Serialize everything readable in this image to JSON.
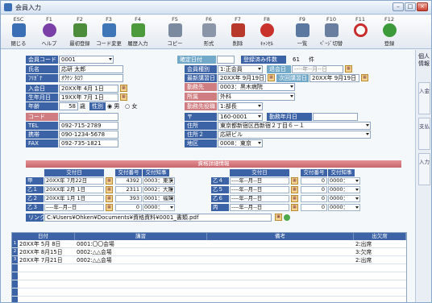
{
  "window": {
    "title": "会員入力",
    "min": "–",
    "max": "□",
    "close": "×"
  },
  "toolbar": [
    {
      "key": "ESC",
      "label": "閉じる",
      "icon": "monitor-icon",
      "color": "#3a6fb5"
    },
    {
      "key": "F1",
      "label": "ヘルプ",
      "icon": "help-icon",
      "color": "#7b3fa8"
    },
    {
      "key": "F2",
      "label": "最初登録",
      "icon": "register-icon",
      "color": "#4c8c3a"
    },
    {
      "key": "F3",
      "label": "コード変更",
      "icon": "code-change-icon",
      "color": "#3e76b8"
    },
    {
      "key": "F4",
      "label": "履歴入力",
      "icon": "history-icon",
      "color": "#4c9a3c"
    },
    {
      "key": "F5",
      "label": "コピー",
      "icon": "copy-icon",
      "color": "#7c8aa0"
    },
    {
      "key": "F6",
      "label": "形式",
      "icon": "format-icon",
      "color": "#8a95a8"
    },
    {
      "key": "F7",
      "label": "削除",
      "icon": "delete-icon",
      "color": "#b8392c"
    },
    {
      "key": "F8",
      "label": "ｷｬﾝｾﾙ",
      "icon": "cancel-icon",
      "color": "#c9322b"
    },
    {
      "key": "F9",
      "label": "一覧",
      "icon": "list-icon",
      "color": "#5a78a0"
    },
    {
      "key": "F10",
      "label": "ﾍﾟｰｼﾞ切替",
      "icon": "page-switch-icon",
      "color": "#6a7ea0"
    },
    {
      "key": "F11",
      "label": "",
      "icon": "prohibit-icon",
      "color": "#c82c2c"
    },
    {
      "key": "F12",
      "label": "登録",
      "icon": "save-check-icon",
      "color": "#3d9a3a"
    }
  ],
  "sidebar": {
    "title": "個人情報",
    "tabs": [
      "入金",
      "支払",
      "入力"
    ]
  },
  "form": {
    "member_code_label": "会員コード",
    "member_code": "0001",
    "name_label": "氏名",
    "name": "応研 太郎",
    "kana_label": "ﾌﾘｶﾞﾅ",
    "kana": "ｵｳｹﾝ ﾀﾛｳ",
    "join_label": "入会日",
    "join_date": "20XX年 4月 1日",
    "birth_label": "生年月日",
    "birth_date": "19XX年 7月 1日",
    "age_label": "年齢",
    "age": "58",
    "age_unit": "歳",
    "gender_label": "性別",
    "gender_male": "男",
    "gender_female": "女",
    "code_label": "コード",
    "code": "",
    "tel_label": "TEL",
    "tel": "092-715-2789",
    "mobile_label": "携帯",
    "mobile": "090-1234-5678",
    "fax_label": "FAX",
    "fax": "092-735-1821",
    "fix_date_label": "確定日付",
    "fix_date": "",
    "reg_count_label": "登録済み件数",
    "reg_count": "61",
    "reg_count_unit": "件",
    "member_type_label": "会員種別",
    "member_type": "1:正会員",
    "withdraw_label": "退会日",
    "withdraw_date": "----年--月--日",
    "latest_lecture_label": "最新講習日",
    "latest_lecture": "20XX年 9月19日",
    "next_lecture_label": "次回講習日",
    "next_lecture": "20XX年 9月19日",
    "workplace_label": "勤務先",
    "workplace": "0003：黒木病院",
    "dept_label": "所属",
    "dept": "外科",
    "position_label": "勤務先役職",
    "position": "1:部長",
    "zip_label": "〒",
    "zip": "160-0001",
    "work_ym_label": "勤務年月日",
    "work_ym": "",
    "addr_label": "住所",
    "addr": "東京都新宿区西新宿２丁目６－１",
    "addr2_label": "住所２",
    "addr2": "応研ビル",
    "region_label": "地区",
    "region": "0008：東京"
  },
  "quals": {
    "section_title": "資格詳細情報",
    "col_date": "交付日",
    "col_no": "交付番号",
    "col_gov": "交付知事",
    "left": [
      {
        "label": "甲",
        "date": "20XX年 7月22日",
        "no": "4392",
        "gov": "0003：東京"
      },
      {
        "label": "乙１",
        "date": "20XX年 2月 1日",
        "no": "2311",
        "gov": "0002：大阪"
      },
      {
        "label": "乙２",
        "date": "20XX年 1月 1日",
        "no": "393",
        "gov": "0001：福岡"
      },
      {
        "label": "乙３",
        "date": "----年--月--日",
        "no": "0",
        "gov": "0000："
      }
    ],
    "right": [
      {
        "label": "乙４",
        "date": "----年--月--日",
        "no": "0",
        "gov": "0000："
      },
      {
        "label": "乙５",
        "date": "----年--月--日",
        "no": "0",
        "gov": "0000："
      },
      {
        "label": "乙６",
        "date": "----年--月--日",
        "no": "0",
        "gov": "0000："
      },
      {
        "label": "丙",
        "date": "----年--月--日",
        "no": "0",
        "gov": "0000："
      }
    ],
    "link_label": "リンク",
    "link_path": "C:¥Users¥Ohken¥Documents¥資格資料¥0001_書類.pdf"
  },
  "grid": {
    "col_date": "日付",
    "col_lecture": "講習",
    "col_note": "備考",
    "col_att": "出欠席",
    "rows": [
      {
        "n": "1",
        "date": "20XX年 5月 8日",
        "lecture": "0001:〇〇会場",
        "note": "",
        "att": "2:出席"
      },
      {
        "n": "2",
        "date": "20XX年 8月15日",
        "lecture": "0002:△△会場",
        "note": "",
        "att": "3:欠席"
      },
      {
        "n": "3",
        "date": "20XX年 7月21日",
        "lecture": "0002:△△会場",
        "note": "",
        "att": "2:出席"
      }
    ]
  }
}
